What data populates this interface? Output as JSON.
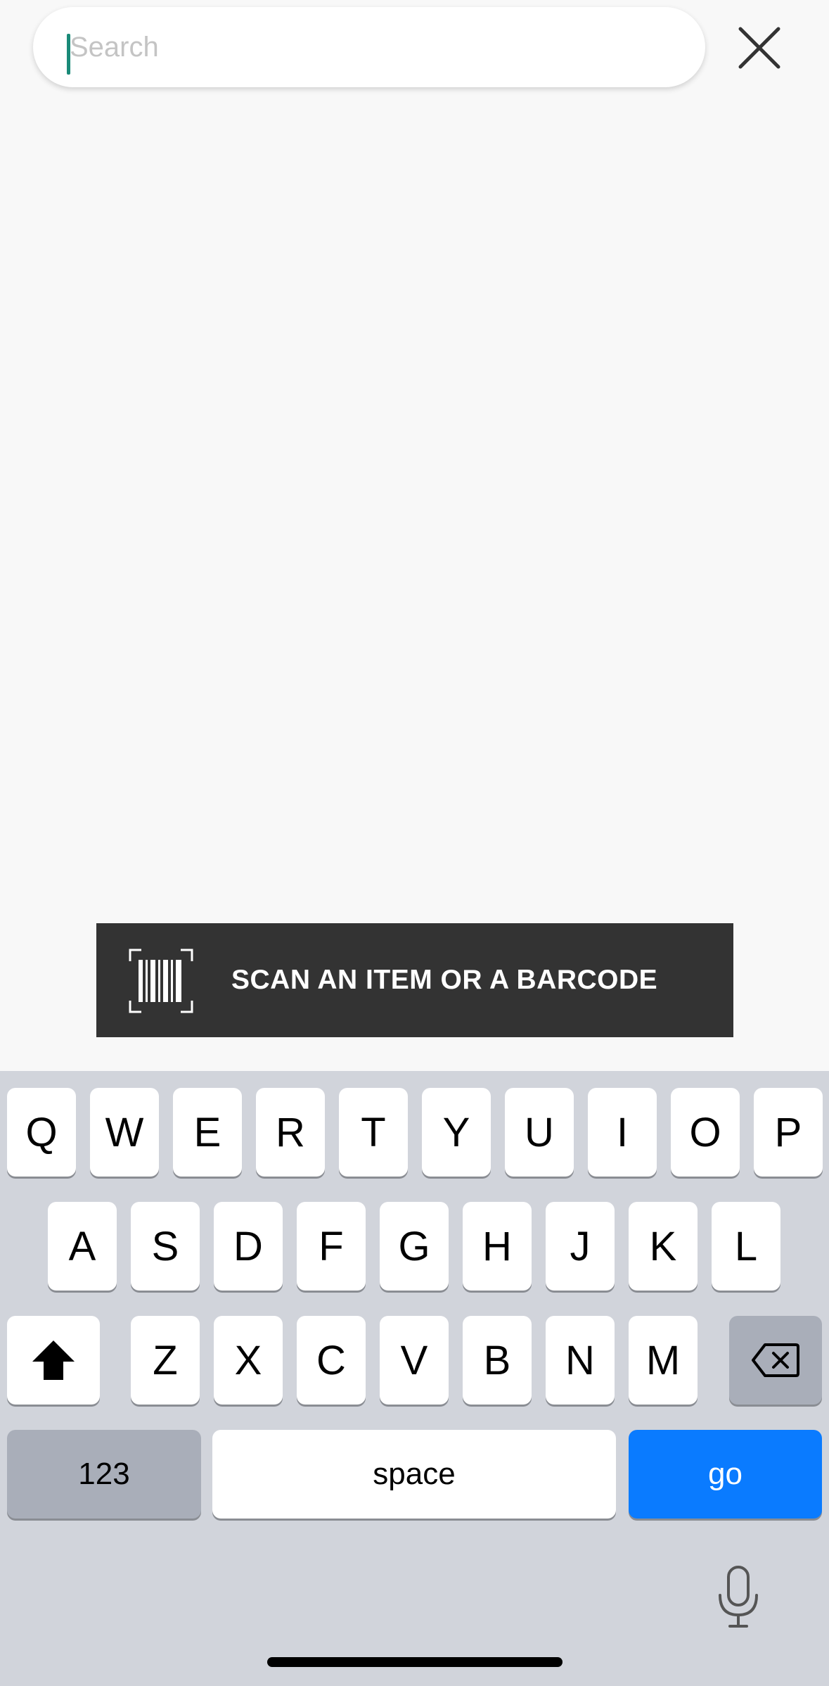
{
  "search": {
    "placeholder": "Search",
    "value": ""
  },
  "scan_banner": {
    "label": "SCAN AN ITEM OR A BARCODE",
    "icon": "barcode-scan-icon"
  },
  "close_icon": "close-icon",
  "keyboard": {
    "row1": [
      "Q",
      "W",
      "E",
      "R",
      "T",
      "Y",
      "U",
      "I",
      "O",
      "P"
    ],
    "row2": [
      "A",
      "S",
      "D",
      "F",
      "G",
      "H",
      "J",
      "K",
      "L"
    ],
    "row3": [
      "Z",
      "X",
      "C",
      "V",
      "B",
      "N",
      "M"
    ],
    "numbers_label": "123",
    "space_label": "space",
    "go_label": "go",
    "shift_icon": "shift-icon",
    "delete_icon": "delete-icon",
    "mic_icon": "microphone-icon"
  },
  "colors": {
    "background": "#f8f8f8",
    "caret": "#1a8a78",
    "banner": "#333333",
    "keyboard_bg": "#d1d4db",
    "go_key": "#0a7bff"
  }
}
